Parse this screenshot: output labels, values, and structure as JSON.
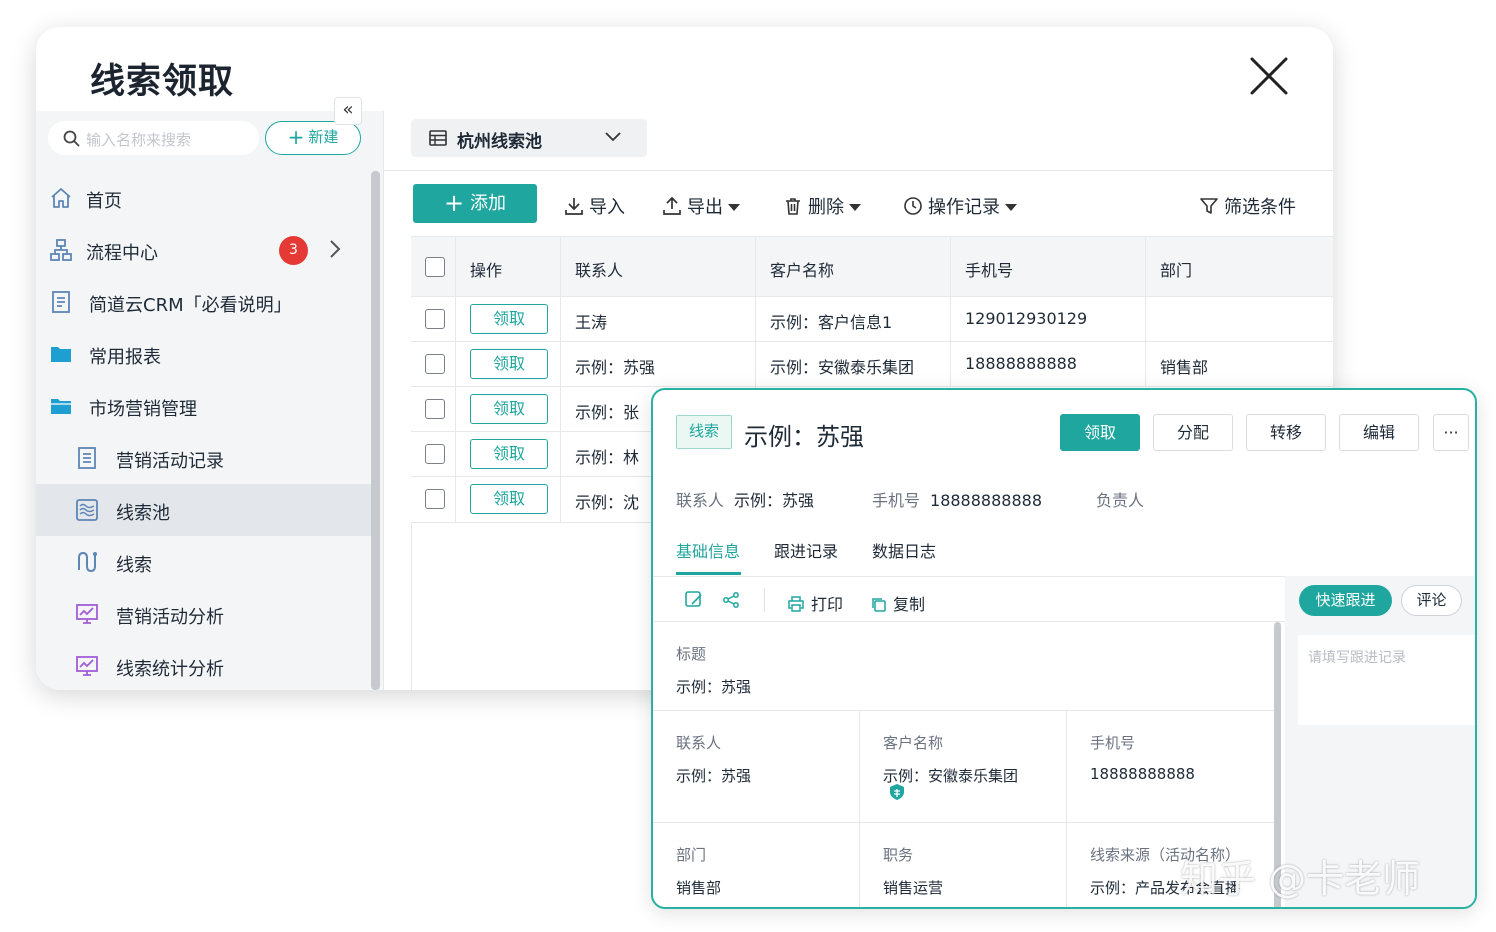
{
  "window": {
    "title": "线索领取"
  },
  "sidebar": {
    "search_placeholder": "输入名称来搜索",
    "new_label": "新建",
    "items": [
      {
        "label": "首页",
        "icon": "home-icon"
      },
      {
        "label": "流程中心",
        "icon": "flow-icon",
        "badge": "3"
      },
      {
        "label": "简道云CRM「必看说明」",
        "icon": "document-icon"
      },
      {
        "label": "常用报表",
        "icon": "folder-icon"
      },
      {
        "label": "市场营销管理",
        "icon": "folder-icon"
      },
      {
        "label": "营销活动记录",
        "icon": "form-icon"
      },
      {
        "label": "线索池",
        "icon": "pool-icon",
        "active": true
      },
      {
        "label": "线索",
        "icon": "lead-icon"
      },
      {
        "label": "营销活动分析",
        "icon": "chart-icon"
      },
      {
        "label": "线索统计分析",
        "icon": "chart-icon"
      }
    ]
  },
  "main": {
    "pool_selector": "杭州线索池",
    "toolbar": {
      "add": "添加",
      "import": "导入",
      "export": "导出",
      "delete": "删除",
      "history": "操作记录",
      "filter": "筛选条件"
    },
    "table": {
      "columns": [
        "操作",
        "联系人",
        "客户名称",
        "手机号",
        "部门"
      ],
      "claim_label": "领取",
      "rows": [
        [
          "王涛",
          "示例：客户信息1",
          "129012930129",
          ""
        ],
        [
          "示例：苏强",
          "示例：安徽泰乐集团",
          "18888888888",
          "销售部"
        ],
        [
          "示例：张",
          "",
          "",
          ""
        ],
        [
          "示例：林",
          "",
          "",
          ""
        ],
        [
          "示例：沈",
          "",
          "",
          ""
        ]
      ]
    }
  },
  "detail": {
    "tag": "线索",
    "title": "示例：苏强",
    "buttons": {
      "claim": "领取",
      "assign": "分配",
      "transfer": "转移",
      "edit": "编辑",
      "more": "···"
    },
    "meta": {
      "contact_label": "联系人",
      "contact_value": "示例：苏强",
      "phone_label": "手机号",
      "phone_value": "18888888888",
      "owner_label": "负责人"
    },
    "tabs": [
      "基础信息",
      "跟进记录",
      "数据日志"
    ],
    "tools": {
      "print": "打印",
      "copy": "复制"
    },
    "side": {
      "quick_follow": "快速跟进",
      "comment": "评论",
      "note_placeholder": "请填写跟进记录"
    },
    "fields": {
      "title_label": "标题",
      "title_value": "示例：苏强",
      "contact_label": "联系人",
      "contact_value": "示例：苏强",
      "customer_label": "客户名称",
      "customer_value": "示例：安徽泰乐集团",
      "phone_label": "手机号",
      "phone_value": "18888888888",
      "dept_label": "部门",
      "dept_value": "销售部",
      "position_label": "职务",
      "position_value": "销售运营",
      "source_label": "线索来源（活动名称）",
      "source_value": "示例：产品发布会直播"
    }
  },
  "watermark": "知乎 @卡老师",
  "colors": {
    "accent": "#1fa69f",
    "badge": "#e53935"
  }
}
